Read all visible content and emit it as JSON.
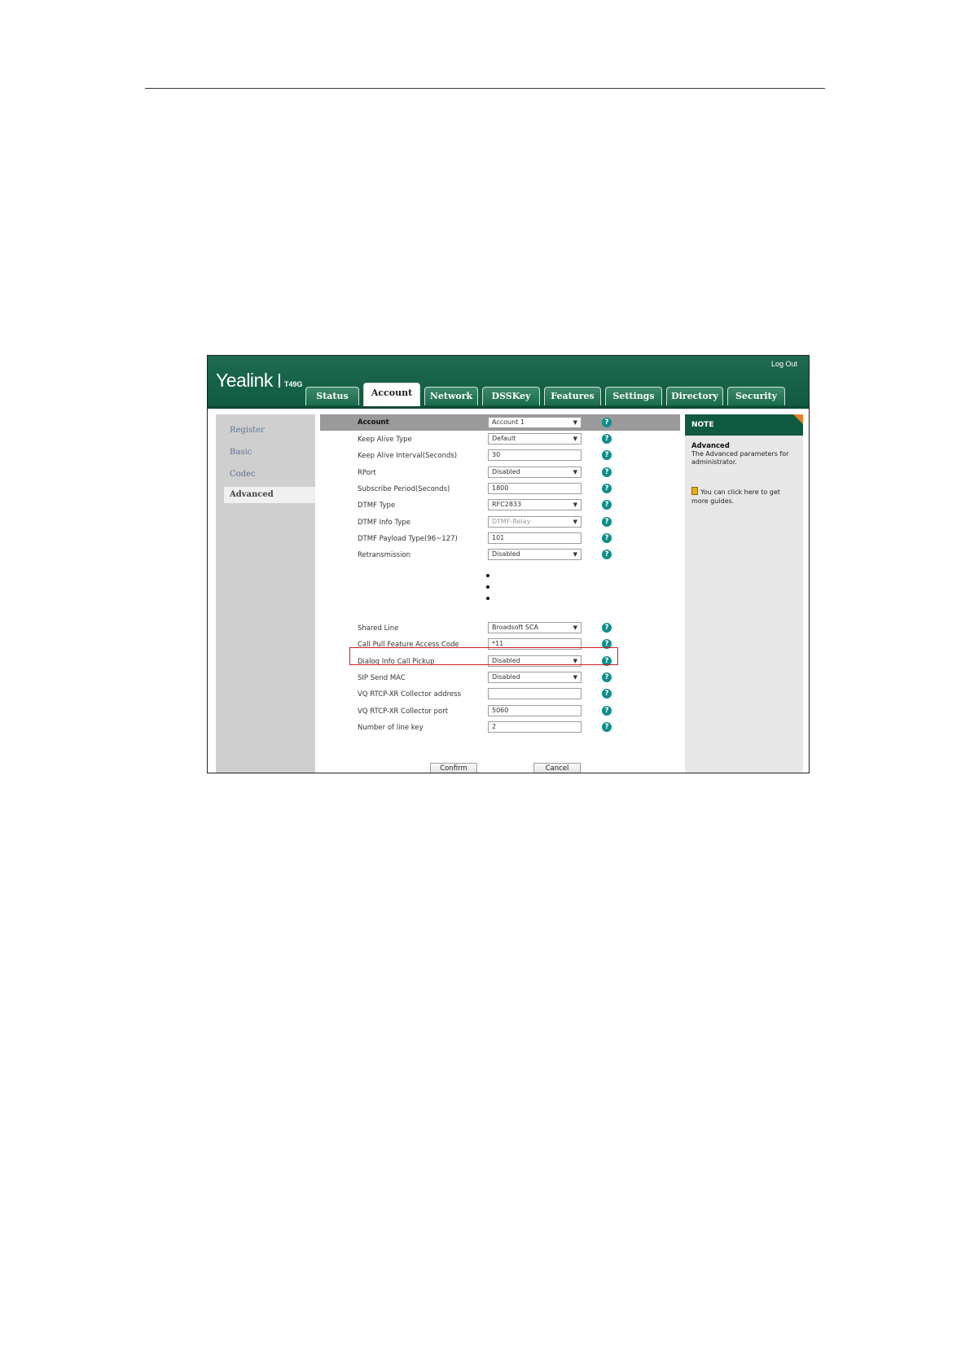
{
  "header": {
    "logo": "Yealink",
    "model": "T49G",
    "logout_label": "Log Out"
  },
  "tabs": [
    {
      "label": "Status"
    },
    {
      "label": "Account"
    },
    {
      "label": "Network"
    },
    {
      "label": "DSSKey"
    },
    {
      "label": "Features"
    },
    {
      "label": "Settings"
    },
    {
      "label": "Directory"
    },
    {
      "label": "Security"
    }
  ],
  "active_tab": "Account",
  "sidebar": {
    "items": [
      {
        "label": "Register"
      },
      {
        "label": "Basic"
      },
      {
        "label": "Codec"
      },
      {
        "label": "Advanced"
      }
    ],
    "active": "Advanced"
  },
  "form": {
    "header_row": {
      "label": "Account",
      "value": "Account 1"
    },
    "rows_top": [
      {
        "label": "Keep Alive Type",
        "value": "Default",
        "type": "select"
      },
      {
        "label": "Keep Alive Interval(Seconds)",
        "value": "30",
        "type": "input"
      },
      {
        "label": "RPort",
        "value": "Disabled",
        "type": "select"
      },
      {
        "label": "Subscribe Period(Seconds)",
        "value": "1800",
        "type": "input"
      },
      {
        "label": "DTMF Type",
        "value": "RFC2833",
        "type": "select"
      },
      {
        "label": "DTMF Info Type",
        "value": "DTMF-Relay",
        "type": "select"
      },
      {
        "label": "DTMF Payload Type(96~127)",
        "value": "101",
        "type": "input"
      },
      {
        "label": "Retransmission",
        "value": "Disabled",
        "type": "select"
      }
    ],
    "rows_bottom": [
      {
        "label": "Shared Line",
        "value": "Broadsoft SCA",
        "type": "select"
      },
      {
        "label": "Call Pull Feature Access Code",
        "value": "*11",
        "type": "input"
      },
      {
        "label": "Dialog Info Call Pickup",
        "value": "Disabled",
        "type": "select"
      },
      {
        "label": "SIP Send MAC",
        "value": "Disabled",
        "type": "select"
      },
      {
        "label": "VQ RTCP-XR Collector address",
        "value": "",
        "type": "input"
      },
      {
        "label": "VQ RTCP-XR Collector port",
        "value": "5060",
        "type": "input"
      },
      {
        "label": "Number of line key",
        "value": "2",
        "type": "input"
      }
    ],
    "confirm_label": "Confirm",
    "cancel_label": "Cancel"
  },
  "note": {
    "header": "NOTE",
    "title": "Advanced",
    "body": "The Advanced parameters for administrator.",
    "link_text": "You can click here to get more guides."
  },
  "colors": {
    "brand_green": "#0f5a40",
    "help_teal": "#0e8e8a",
    "highlight_red": "#d11c1c",
    "note_corner": "#e8802a"
  }
}
